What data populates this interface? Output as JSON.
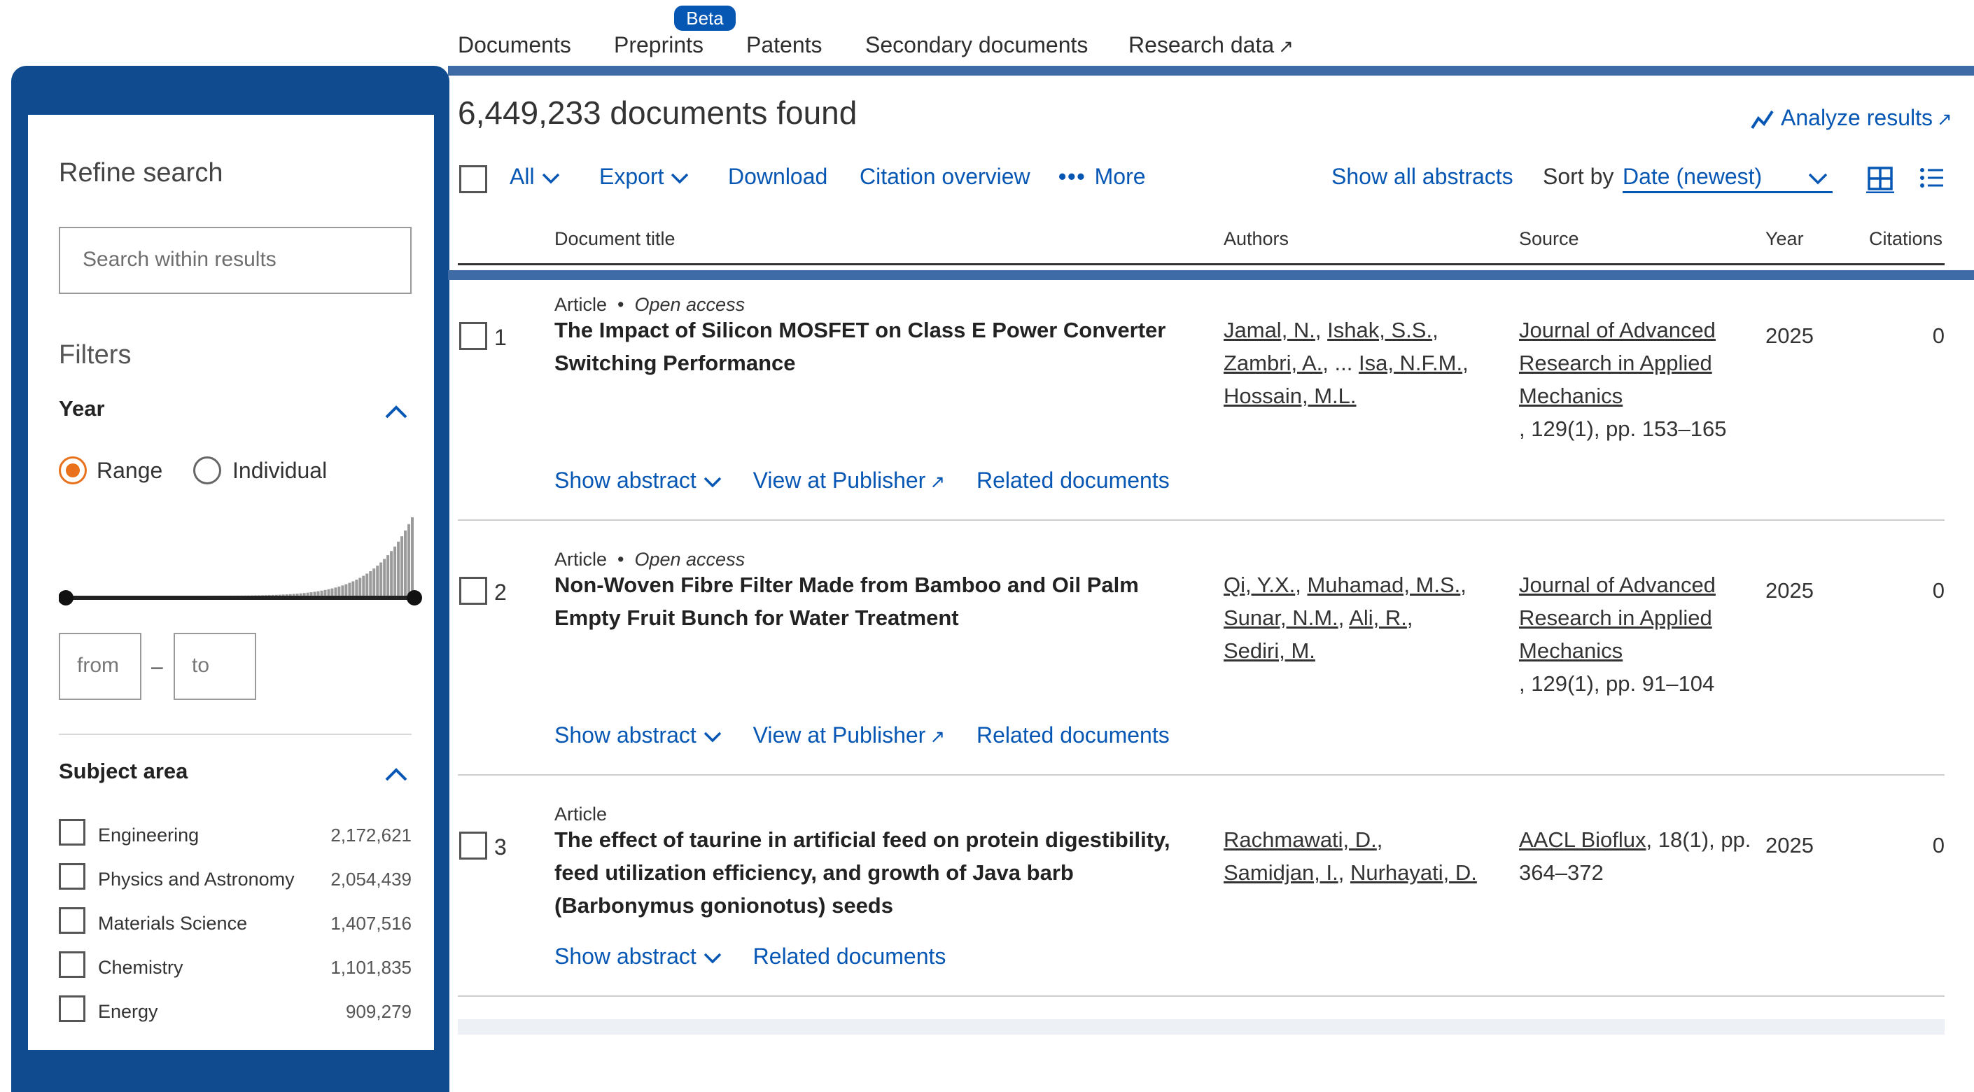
{
  "tabs": {
    "items": [
      "Documents",
      "Preprints",
      "Patents",
      "Secondary documents",
      "Research data"
    ],
    "beta_badge": "Beta"
  },
  "filters": {
    "refine_title": "Refine search",
    "search_placeholder": "Search within results",
    "filters_title": "Filters",
    "year": {
      "title": "Year",
      "range_label": "Range",
      "individual_label": "Individual",
      "selected": "Range",
      "from_placeholder": "from",
      "to_placeholder": "to",
      "dash": "–"
    },
    "subject_area": {
      "title": "Subject area",
      "items": [
        {
          "name": "Engineering",
          "count": "2,172,621"
        },
        {
          "name": "Physics and Astronomy",
          "count": "2,054,439"
        },
        {
          "name": "Materials Science",
          "count": "1,407,516"
        },
        {
          "name": "Chemistry",
          "count": "1,101,835"
        },
        {
          "name": "Energy",
          "count": "909,279"
        }
      ]
    }
  },
  "results": {
    "count_text": "6,449,233 documents found",
    "analyze_label": "Analyze results",
    "toolbar": {
      "all": "All",
      "export": "Export",
      "download": "Download",
      "citation_overview": "Citation overview",
      "more": "More",
      "show_all_abstracts": "Show all abstracts",
      "sort_by": "Sort by",
      "sort_value": "Date (newest)"
    },
    "columns": {
      "title": "Document title",
      "authors": "Authors",
      "source": "Source",
      "year": "Year",
      "citations": "Citations"
    },
    "items": [
      {
        "index": "1",
        "type": "Article",
        "access": "Open access",
        "title": "The Impact of Silicon MOSFET on Class E Power Converter Switching Performance",
        "authors": [
          "Jamal, N.",
          "Ishak, S.S.",
          "Zambri, A.",
          "Isa, N.F.M.",
          "Hossain, M.L."
        ],
        "ellipsis": "...",
        "source_name": "Journal of Advanced Research in Applied Mechanics",
        "source_detail": ", 129(1), pp. 153–165",
        "year": "2025",
        "citations": "0",
        "actions": [
          "Show abstract",
          "View at Publisher",
          "Related documents"
        ]
      },
      {
        "index": "2",
        "type": "Article",
        "access": "Open access",
        "title": "Non-Woven Fibre Filter Made from Bamboo and Oil Palm Empty Fruit Bunch for Water Treatment",
        "authors": [
          "Qi, Y.X.",
          "Muhamad, M.S.",
          "Sunar, N.M.",
          "Ali, R.",
          "Sediri, M."
        ],
        "source_name": "Journal of Advanced Research in Applied Mechanics",
        "source_detail": ", 129(1), pp. 91–104",
        "year": "2025",
        "citations": "0",
        "actions": [
          "Show abstract",
          "View at Publisher",
          "Related documents"
        ]
      },
      {
        "index": "3",
        "type": "Article",
        "title": "The effect of taurine in artificial feed on protein digestibility, feed utilization efficiency, and growth of Java barb (Barbonymus gonionotus) seeds",
        "authors": [
          "Rachmawati, D.",
          "Samidjan, I.",
          "Nurhayati, D."
        ],
        "source_name": "AACL Bioflux",
        "source_detail": ", 18(1), pp. 364–372",
        "year": "2025",
        "citations": "0",
        "actions": [
          "Show abstract",
          "Related documents"
        ]
      }
    ]
  },
  "colors": {
    "link": "#0656b4",
    "panel_frame": "#0f4b8e",
    "radio_selected": "#e9711c"
  },
  "icons": [
    "external-link-icon",
    "analyze-chart-icon",
    "chevron-down-icon",
    "chevron-up-icon",
    "more-dots-icon",
    "grid-view-icon",
    "list-view-icon"
  ]
}
